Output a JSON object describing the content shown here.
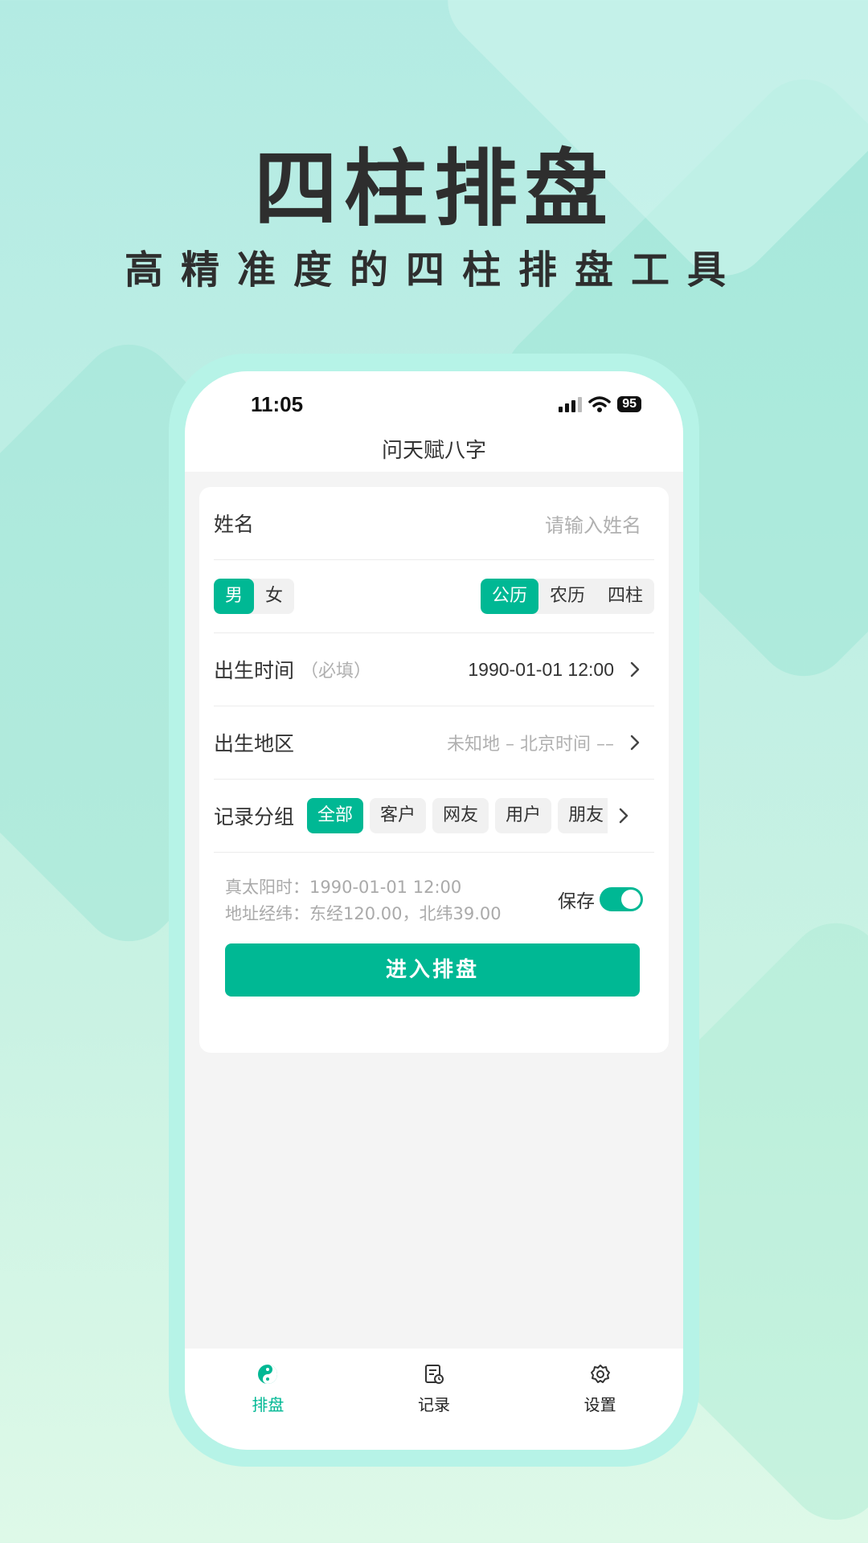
{
  "promo": {
    "headline": "四柱排盘",
    "subline": "高精准度的四柱排盘工具"
  },
  "status_bar": {
    "time": "11:05",
    "battery": "95"
  },
  "app": {
    "title": "问天赋八字"
  },
  "form": {
    "name": {
      "label": "姓名",
      "placeholder": "请输入姓名"
    },
    "gender": {
      "options": [
        "男",
        "女"
      ],
      "selected": "男"
    },
    "calendar": {
      "options": [
        "公历",
        "农历",
        "四柱"
      ],
      "selected": "公历"
    },
    "birth_time": {
      "label": "出生时间",
      "hint": "（必填）",
      "value": "1990-01-01 12:00"
    },
    "birth_place": {
      "label": "出生地区",
      "value": "未知地 – 北京时间 ––"
    },
    "group": {
      "label": "记录分组",
      "options": [
        "全部",
        "客户",
        "网友",
        "用户",
        "朋友"
      ],
      "selected": "全部"
    },
    "solar_time": "真太阳时：1990-01-01 12:00",
    "coordinates": "地址经纬：东经120.00，北纬39.00",
    "save": {
      "label": "保存",
      "on": true
    },
    "submit_label": "进入排盘"
  },
  "tabs": [
    {
      "label": "排盘",
      "icon": "yin-yang-icon",
      "active": true
    },
    {
      "label": "记录",
      "icon": "record-icon",
      "active": false
    },
    {
      "label": "设置",
      "icon": "gear-icon",
      "active": false
    }
  ],
  "colors": {
    "accent": "#00b894",
    "background_top": "#b3ebe3",
    "background_bottom": "#def9e8",
    "phone_frame": "#b6f3e7"
  }
}
